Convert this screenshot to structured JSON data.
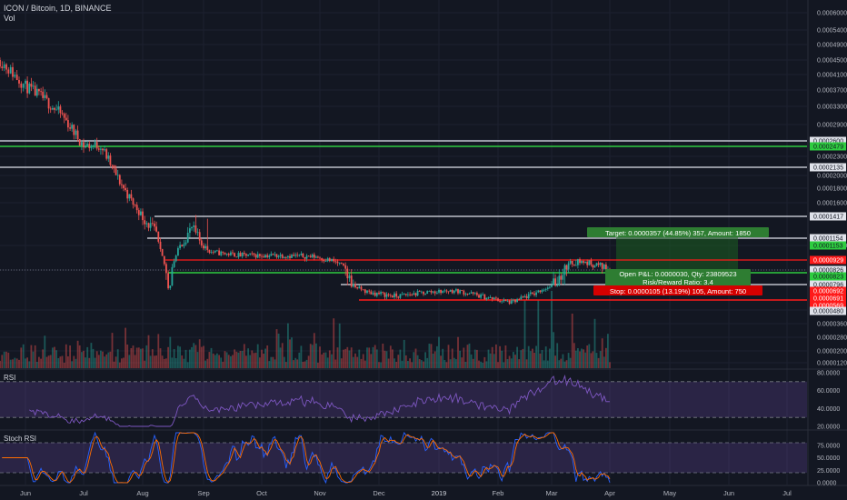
{
  "header": {
    "symbol_line": "ICON / Bitcoin, 1D, BINANCE",
    "volume_label": "Vol"
  },
  "panes": {
    "rsi_label": "RSI",
    "stoch_label": "Stoch RSI"
  },
  "colors": {
    "background": "#131722",
    "up": "#26a69a",
    "down": "#ef5350",
    "green_line": "#2ecc40",
    "red_line": "#ff1a1a",
    "white_line": "#e0e3eb",
    "rsi_band": "#7e57c2"
  },
  "chart_data": [
    {
      "type": "candlestick",
      "title": "ICON / Bitcoin, 1D, BINANCE",
      "x_tick_labels": [
        "Jun",
        "Jul",
        "Aug",
        "Sep",
        "Oct",
        "Nov",
        "Dec",
        "2019",
        "Feb",
        "Mar",
        "Apr",
        "May",
        "Jun",
        "Jul"
      ],
      "y_tick_labels": [
        "0.0006000",
        "0.0005400",
        "0.0004900",
        "0.0004500",
        "0.0004100",
        "0.0003700",
        "0.0003300",
        "0.0002900",
        "0.0002300",
        "0.0002000",
        "0.0001800",
        "0.0001600",
        "0.0001200",
        "0.0000360",
        "0.0000280",
        "0.0000200",
        "0.0000120"
      ],
      "price_path": [
        {
          "date": "2018-05-20",
          "close": 0.00045
        },
        {
          "date": "2018-06-01",
          "close": 0.00038
        },
        {
          "date": "2018-06-10",
          "close": 0.00035
        },
        {
          "date": "2018-06-20",
          "close": 0.00031
        },
        {
          "date": "2018-07-01",
          "close": 0.00025
        },
        {
          "date": "2018-07-10",
          "close": 0.00025
        },
        {
          "date": "2018-07-20",
          "close": 0.00019
        },
        {
          "date": "2018-08-01",
          "close": 0.00014
        },
        {
          "date": "2018-08-08",
          "close": 0.000125
        },
        {
          "date": "2018-08-14",
          "close": 7.5e-05
        },
        {
          "date": "2018-08-20",
          "close": 0.000115
        },
        {
          "date": "2018-08-26",
          "close": 0.00013
        },
        {
          "date": "2018-09-05",
          "close": 0.000105
        },
        {
          "date": "2018-09-20",
          "close": 0.0001
        },
        {
          "date": "2018-10-10",
          "close": 0.0001
        },
        {
          "date": "2018-10-30",
          "close": 9.8e-05
        },
        {
          "date": "2018-11-10",
          "close": 9e-05
        },
        {
          "date": "2018-11-25",
          "close": 6.8e-05
        },
        {
          "date": "2018-12-10",
          "close": 6.4e-05
        },
        {
          "date": "2018-12-25",
          "close": 6.8e-05
        },
        {
          "date": "2019-01-10",
          "close": 7e-05
        },
        {
          "date": "2019-01-28",
          "close": 6.2e-05
        },
        {
          "date": "2019-02-08",
          "close": 5.8e-05
        },
        {
          "date": "2019-02-20",
          "close": 6.7e-05
        },
        {
          "date": "2019-03-01",
          "close": 7.7e-05
        },
        {
          "date": "2019-03-10",
          "close": 8.8e-05
        },
        {
          "date": "2019-03-15",
          "close": 9.2e-05
        },
        {
          "date": "2019-03-25",
          "close": 8.8e-05
        },
        {
          "date": "2019-04-01",
          "close": 8.5e-05
        }
      ],
      "price_tags": [
        {
          "label": "0.0002600",
          "color": "white"
        },
        {
          "label": "0.0002479",
          "color": "green"
        },
        {
          "label": "0.0002135",
          "color": "white"
        },
        {
          "label": "0.0001417",
          "color": "white"
        },
        {
          "label": "0.0001154",
          "color": "white"
        },
        {
          "label": "0.0001153",
          "color": "green"
        },
        {
          "label": "0.0000929",
          "color": "red"
        },
        {
          "label": "0.0000826",
          "color": "white"
        },
        {
          "label": "0.0000823",
          "color": "green"
        },
        {
          "label": "0.0000796",
          "color": "white"
        },
        {
          "label": "0.0000692",
          "color": "red"
        },
        {
          "label": "0.0000691",
          "color": "red"
        },
        {
          "label": "0.0000569",
          "color": "red"
        },
        {
          "label": "0.0000480",
          "color": "white"
        }
      ],
      "position": {
        "target_text": "Target: 0.0000357 (44.85%) 357, Amount: 1850",
        "open_pl_text": "Open P&L: 0.0000030, Qty: 23809523",
        "risk_reward_text": "Risk/Reward Ratio: 3.4",
        "stop_text": "Stop: 0.0000105 (13.19%) 105, Amount: 750"
      }
    },
    {
      "type": "line",
      "title": "RSI",
      "y_tick_labels": [
        "80.0000",
        "60.0000",
        "40.0000",
        "20.0000"
      ],
      "band": [
        30,
        70
      ],
      "ylim": [
        20,
        80
      ]
    },
    {
      "type": "line",
      "title": "Stoch RSI",
      "y_tick_labels": [
        "75.0000",
        "50.0000",
        "25.0000",
        "0.0000"
      ],
      "band": [
        20,
        80
      ],
      "ylim": [
        0,
        100
      ],
      "series": [
        {
          "color": "#2962ff"
        },
        {
          "color": "#ff6d00"
        }
      ]
    }
  ]
}
